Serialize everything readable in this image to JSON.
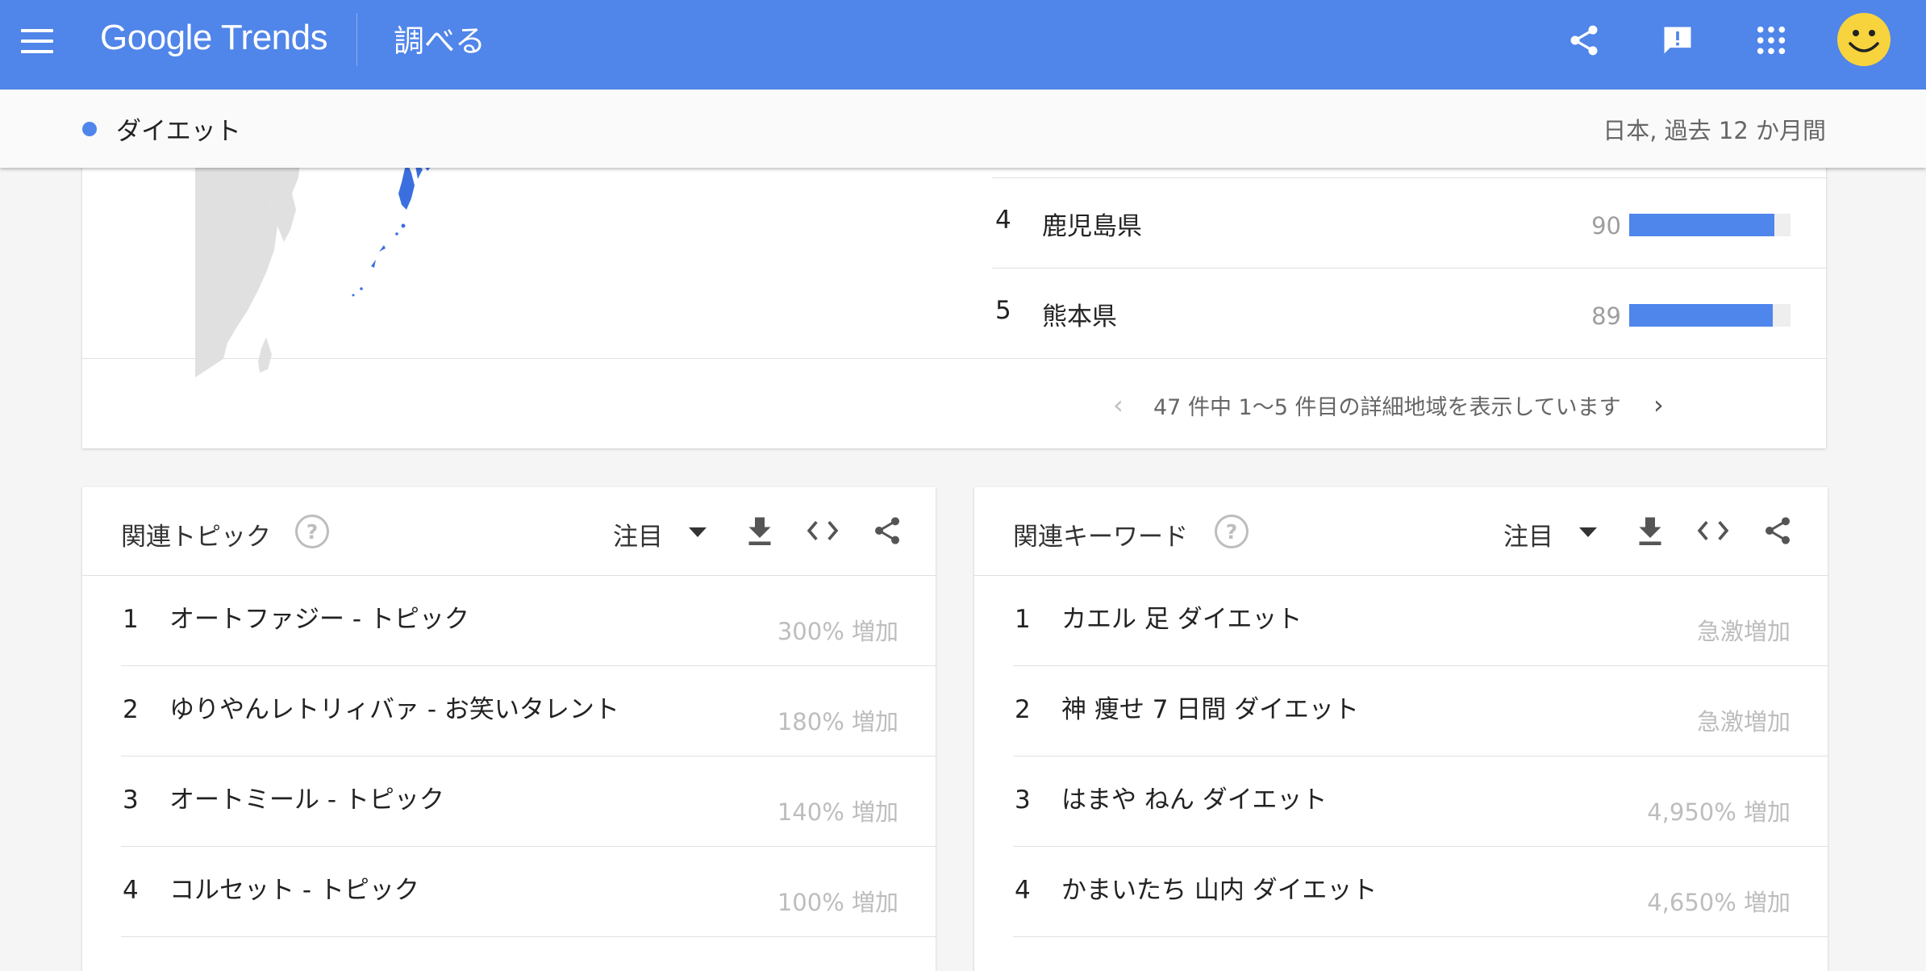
{
  "header": {
    "logo_text": "Google Trends",
    "page_title": "調べる",
    "icons": [
      "menu-icon",
      "share-icon",
      "feedback-icon",
      "apps-icon",
      "avatar"
    ],
    "accent_color": "#5085e9"
  },
  "subbar": {
    "term": "ダイエット",
    "term_color": "#4f86ec",
    "scope": "日本, 過去 12 か月間"
  },
  "regions": {
    "items": [
      {
        "rank": "4",
        "name": "鹿児島県",
        "value": 90
      },
      {
        "rank": "5",
        "name": "熊本県",
        "value": 89
      }
    ],
    "pager_text": "47 件中 1〜5 件目の詳細地域を表示しています"
  },
  "related_topics": {
    "title": "関連トピック",
    "filter": "注目",
    "items": [
      {
        "rank": "1",
        "name": "オートファジー - トピック",
        "value": "300% 増加"
      },
      {
        "rank": "2",
        "name": "ゆりやんレトリィバァ - お笑いタレント",
        "value": "180% 増加"
      },
      {
        "rank": "3",
        "name": "オートミール - トピック",
        "value": "140% 増加"
      },
      {
        "rank": "4",
        "name": "コルセット - トピック",
        "value": "100% 増加"
      }
    ]
  },
  "related_queries": {
    "title": "関連キーワード",
    "filter": "注目",
    "items": [
      {
        "rank": "1",
        "name": "カエル 足 ダイエット",
        "value": "急激増加"
      },
      {
        "rank": "2",
        "name": "神 痩せ 7 日間 ダイエット",
        "value": "急激増加"
      },
      {
        "rank": "3",
        "name": "はまや ねん ダイエット",
        "value": "4,950% 増加"
      },
      {
        "rank": "4",
        "name": "かまいたち 山内 ダイエット",
        "value": "4,650% 増加"
      }
    ]
  }
}
